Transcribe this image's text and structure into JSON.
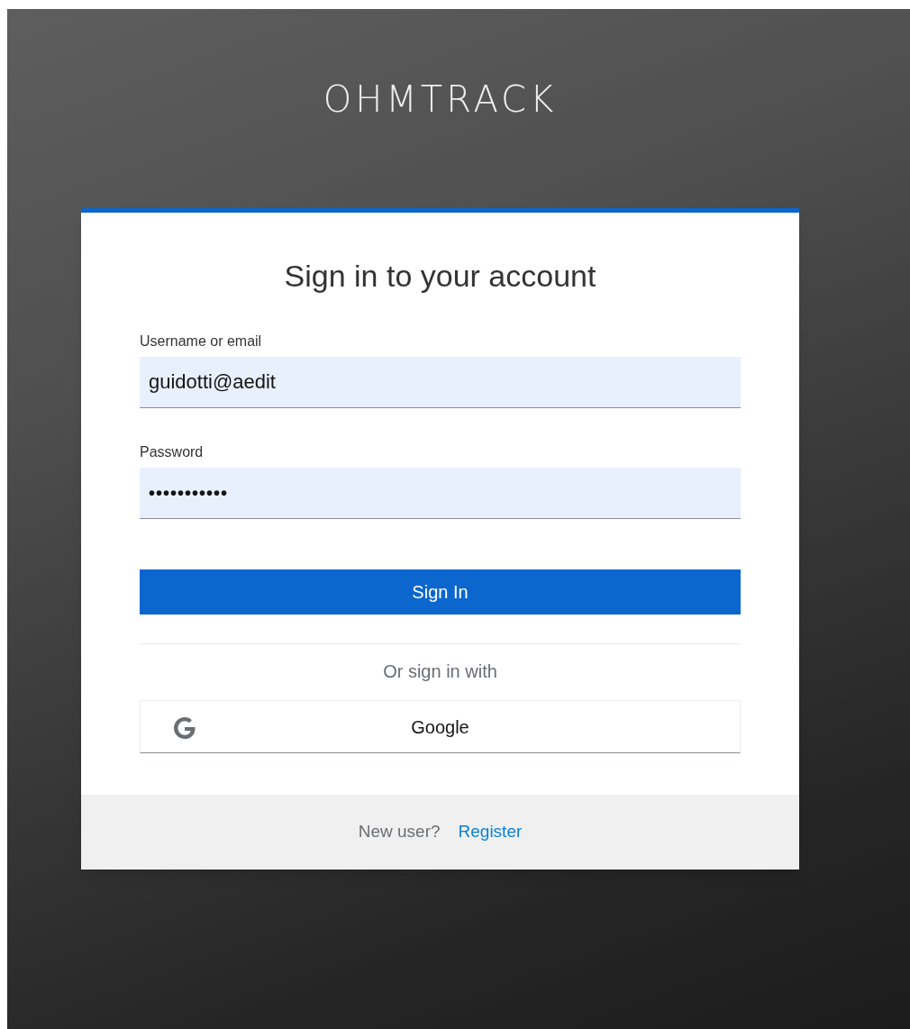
{
  "brand": "OHMTRACK",
  "card": {
    "title": "Sign in to your account",
    "fields": [
      {
        "label": "Username or email",
        "value": "guidotti@aedit",
        "kind": "text"
      },
      {
        "label": "Password",
        "value": "•••••••••••",
        "kind": "password"
      }
    ],
    "submit": "Sign In",
    "divider_text": "Or sign in with",
    "providers": [
      {
        "label": "Google"
      }
    ],
    "footer": {
      "text": "New user?",
      "link": "Register"
    }
  }
}
